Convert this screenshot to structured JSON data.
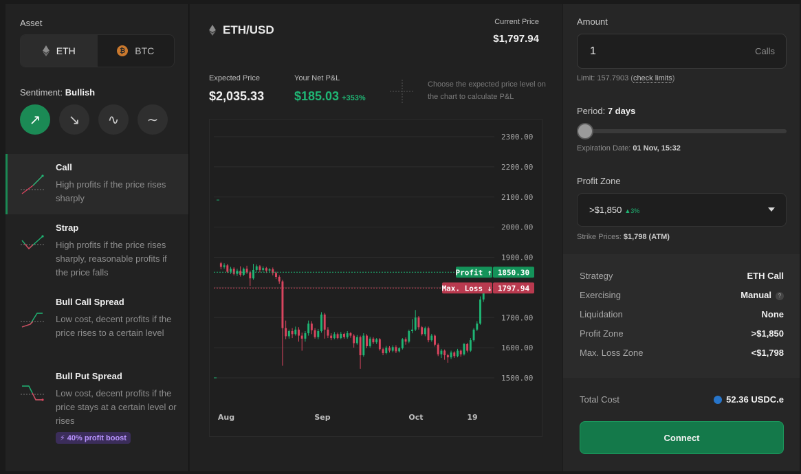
{
  "asset": {
    "label": "Asset",
    "options": [
      {
        "name": "ETH",
        "icon": "eth-icon",
        "active": true
      },
      {
        "name": "BTC",
        "icon": "btc-icon",
        "active": false
      }
    ]
  },
  "sentiment": {
    "label": "Sentiment:",
    "value": "Bullish",
    "buttons": [
      "bullish-icon",
      "bearish-icon",
      "volatile-icon",
      "neutral-icon"
    ],
    "glyphs": [
      "↗",
      "↘",
      "∿",
      "∼"
    ]
  },
  "strategies": [
    {
      "title": "Call",
      "desc": "High profits if the price rises sharply",
      "active": true
    },
    {
      "title": "Strap",
      "desc": "High profits if the price rises sharply, reasonable profits if the price falls",
      "active": false
    },
    {
      "title": "Bull Call Spread",
      "desc": "Low cost, decent profits if the price rises to a certain level",
      "active": false
    },
    {
      "title": "Bull Put Spread",
      "desc": "Low cost, decent profits if the price stays at a certain level or rises",
      "active": false,
      "badge": "⚡ 40% profit boost"
    }
  ],
  "header": {
    "pair": "ETH/USD",
    "current_price_label": "Current Price",
    "current_price": "$1,797.94",
    "expected_price_label": "Expected Price",
    "expected_price": "$2,035.33",
    "net_pnl_label": "Your Net P&L",
    "net_pnl": "$185.03",
    "net_pnl_pct": "+353%",
    "hint": "Choose the expected price level on the chart to calculate P&L"
  },
  "chart_data": {
    "type": "candlestick",
    "y_ticks": [
      "2300.00",
      "2200.00",
      "2100.00",
      "2000.00",
      "1900.00",
      "1800.00",
      "1700.00",
      "1600.00",
      "1500.00"
    ],
    "ylim": [
      1500,
      2300
    ],
    "x_ticks": [
      "Aug",
      "Sep",
      "Oct",
      "19"
    ],
    "profit_line": {
      "label": "Profit ↑",
      "value": "1850.30"
    },
    "loss_line": {
      "label": "Max. Loss ↓",
      "value": "1797.94"
    },
    "colors": {
      "up": "#1fb574",
      "down": "#d9455f"
    },
    "candles": [
      [
        1880,
        1868,
        1885,
        1860
      ],
      [
        1868,
        1873,
        1880,
        1862
      ],
      [
        1873,
        1852,
        1878,
        1848
      ],
      [
        1852,
        1862,
        1868,
        1845
      ],
      [
        1862,
        1845,
        1867,
        1840
      ],
      [
        1845,
        1855,
        1862,
        1838
      ],
      [
        1855,
        1842,
        1870,
        1836
      ],
      [
        1842,
        1862,
        1866,
        1838
      ],
      [
        1862,
        1850,
        1872,
        1845
      ],
      [
        1850,
        1830,
        1856,
        1805
      ],
      [
        1830,
        1858,
        1878,
        1826
      ],
      [
        1858,
        1870,
        1876,
        1852
      ],
      [
        1870,
        1858,
        1874,
        1850
      ],
      [
        1858,
        1864,
        1870,
        1852
      ],
      [
        1864,
        1856,
        1868,
        1848
      ],
      [
        1856,
        1860,
        1864,
        1850
      ],
      [
        1860,
        1848,
        1866,
        1840
      ],
      [
        1848,
        1835,
        1852,
        1828
      ],
      [
        1835,
        1820,
        1840,
        1812
      ],
      [
        1820,
        1665,
        1825,
        1540
      ],
      [
        1665,
        1638,
        1690,
        1628
      ],
      [
        1638,
        1655,
        1660,
        1630
      ],
      [
        1655,
        1645,
        1665,
        1632
      ],
      [
        1645,
        1660,
        1670,
        1640
      ],
      [
        1660,
        1640,
        1668,
        1620
      ],
      [
        1640,
        1630,
        1650,
        1590
      ],
      [
        1630,
        1648,
        1655,
        1620
      ],
      [
        1648,
        1680,
        1690,
        1640
      ],
      [
        1680,
        1658,
        1688,
        1645
      ],
      [
        1658,
        1635,
        1665,
        1630
      ],
      [
        1635,
        1655,
        1662,
        1628
      ],
      [
        1655,
        1710,
        1718,
        1650
      ],
      [
        1710,
        1660,
        1715,
        1630
      ],
      [
        1660,
        1640,
        1668,
        1632
      ],
      [
        1640,
        1632,
        1648,
        1625
      ],
      [
        1632,
        1645,
        1652,
        1628
      ],
      [
        1645,
        1632,
        1650,
        1628
      ],
      [
        1632,
        1646,
        1652,
        1628
      ],
      [
        1646,
        1635,
        1650,
        1630
      ],
      [
        1635,
        1648,
        1655,
        1630
      ],
      [
        1648,
        1640,
        1652,
        1633
      ],
      [
        1640,
        1615,
        1645,
        1600
      ],
      [
        1615,
        1635,
        1642,
        1610
      ],
      [
        1635,
        1575,
        1640,
        1530
      ],
      [
        1575,
        1640,
        1648,
        1570
      ],
      [
        1640,
        1605,
        1645,
        1598
      ],
      [
        1605,
        1630,
        1636,
        1600
      ],
      [
        1630,
        1618,
        1635,
        1612
      ],
      [
        1618,
        1628,
        1632,
        1612
      ],
      [
        1628,
        1595,
        1632,
        1590
      ],
      [
        1595,
        1582,
        1600,
        1575
      ],
      [
        1582,
        1600,
        1606,
        1578
      ],
      [
        1600,
        1590,
        1605,
        1584
      ],
      [
        1590,
        1602,
        1608,
        1585
      ],
      [
        1602,
        1588,
        1608,
        1582
      ],
      [
        1588,
        1598,
        1602,
        1584
      ],
      [
        1598,
        1628,
        1632,
        1594
      ],
      [
        1628,
        1620,
        1634,
        1610
      ],
      [
        1620,
        1655,
        1660,
        1615
      ],
      [
        1655,
        1660,
        1695,
        1648
      ],
      [
        1660,
        1700,
        1725,
        1655
      ],
      [
        1700,
        1668,
        1705,
        1660
      ],
      [
        1668,
        1645,
        1672,
        1640
      ],
      [
        1645,
        1665,
        1670,
        1638
      ],
      [
        1665,
        1625,
        1670,
        1618
      ],
      [
        1625,
        1640,
        1646,
        1620
      ],
      [
        1640,
        1610,
        1644,
        1604
      ],
      [
        1610,
        1578,
        1615,
        1572
      ],
      [
        1578,
        1590,
        1596,
        1566
      ],
      [
        1590,
        1575,
        1594,
        1560
      ],
      [
        1575,
        1568,
        1580,
        1550
      ],
      [
        1568,
        1584,
        1590,
        1562
      ],
      [
        1584,
        1572,
        1588,
        1566
      ],
      [
        1572,
        1590,
        1596,
        1568
      ],
      [
        1590,
        1578,
        1594,
        1570
      ],
      [
        1578,
        1612,
        1616,
        1574
      ],
      [
        1612,
        1590,
        1616,
        1584
      ],
      [
        1590,
        1625,
        1632,
        1586
      ],
      [
        1625,
        1660,
        1665,
        1620
      ],
      [
        1660,
        1680,
        1688,
        1655
      ],
      [
        1680,
        1760,
        1770,
        1676
      ],
      [
        1760,
        1795,
        1808,
        1752
      ],
      [
        1795,
        1790,
        1800,
        1785
      ],
      [
        1790,
        1798,
        1805,
        1786
      ]
    ]
  },
  "order": {
    "amount_label": "Amount",
    "amount_value": "1",
    "amount_unit": "Calls",
    "limit_prefix": "Limit: 157.7903 (",
    "limit_link": "check limits",
    "limit_suffix": ")",
    "period_label": "Period:",
    "period_value": "7 days",
    "period_position": 0,
    "expiration_label": "Expiration Date:",
    "expiration_value": "01 Nov, 15:32",
    "profit_zone_label": "Profit Zone",
    "profit_zone_value": ">$1,850",
    "profit_zone_pct": "▲3%",
    "strike_label": "Strike Prices:",
    "strike_value": "$1,798 (ATM)"
  },
  "summary": [
    {
      "key": "Strategy",
      "value": "ETH Call"
    },
    {
      "key": "Exercising",
      "value": "Manual",
      "help": "?"
    },
    {
      "key": "Liquidation",
      "value": "None"
    },
    {
      "key": "Profit Zone",
      "value": ">$1,850"
    },
    {
      "key": "Max. Loss Zone",
      "value": "<$1,798"
    }
  ],
  "total": {
    "label": "Total Cost",
    "value": "52.36 USDC.e"
  },
  "connect_label": "Connect"
}
